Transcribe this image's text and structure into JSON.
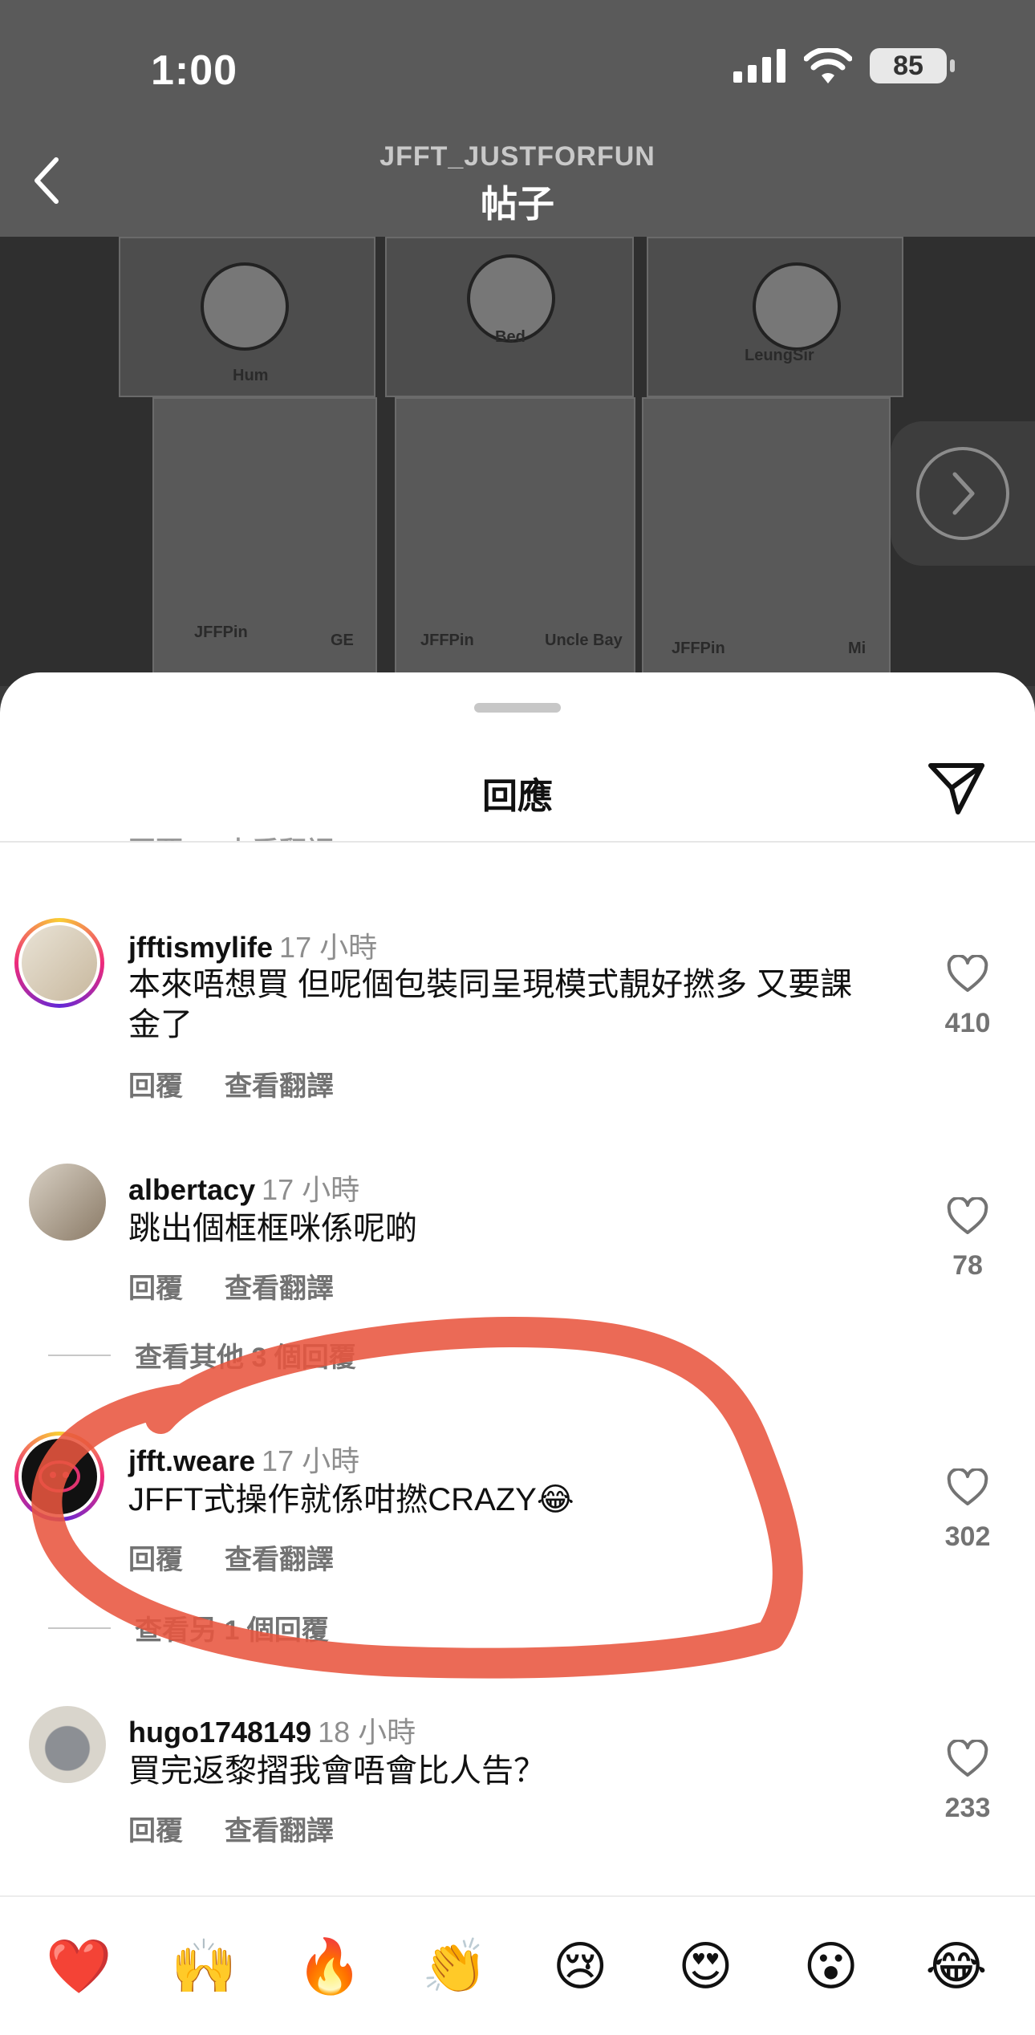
{
  "status_bar": {
    "time": "1:00",
    "battery": "85"
  },
  "nav": {
    "account": "JFFT_JUSTFORFUN",
    "title": "帖子"
  },
  "post_image": {
    "labels": [
      "Hum",
      "Bed",
      "LeungSir",
      "JFFPin",
      "JFFPin",
      "JFFPin",
      "GE",
      "Uncle Bay",
      "Mi"
    ]
  },
  "sheet": {
    "title": "回應",
    "cut_reply": "回覆",
    "cut_translate": "查看翻譯"
  },
  "comments": [
    {
      "username": "jfftismylife",
      "time": "17 小時",
      "text": "本來唔想買 但呢個包裝同呈現模式靚好撚多 又要課金了",
      "reply": "回覆",
      "translate": "查看翻譯",
      "likes": "410"
    },
    {
      "username": "albertacy",
      "time": "17 小時",
      "text": "跳出個框框咪係呢啲",
      "reply": "回覆",
      "translate": "查看翻譯",
      "likes": "78",
      "more_replies": "查看其他 3 個回覆"
    },
    {
      "username": "jfft.weare",
      "time": "17 小時",
      "text": "JFFT式操作就係咁撚CRAZY😂",
      "reply": "回覆",
      "translate": "查看翻譯",
      "likes": "302",
      "more_replies": "查看另 1 個回覆"
    },
    {
      "username": "hugo1748149",
      "time": "18 小時",
      "text": "買完返黎摺我會唔會比人告？",
      "reply": "回覆",
      "translate": "查看翻譯",
      "likes": "233"
    }
  ],
  "emoji_bar": [
    "❤️",
    "🙌",
    "🔥",
    "👏",
    "😢",
    "😍",
    "😮",
    "😂"
  ],
  "colors": {
    "highlight": "#e8553f",
    "like_gray": "#737373",
    "sheet_bg": "#ffffff"
  }
}
